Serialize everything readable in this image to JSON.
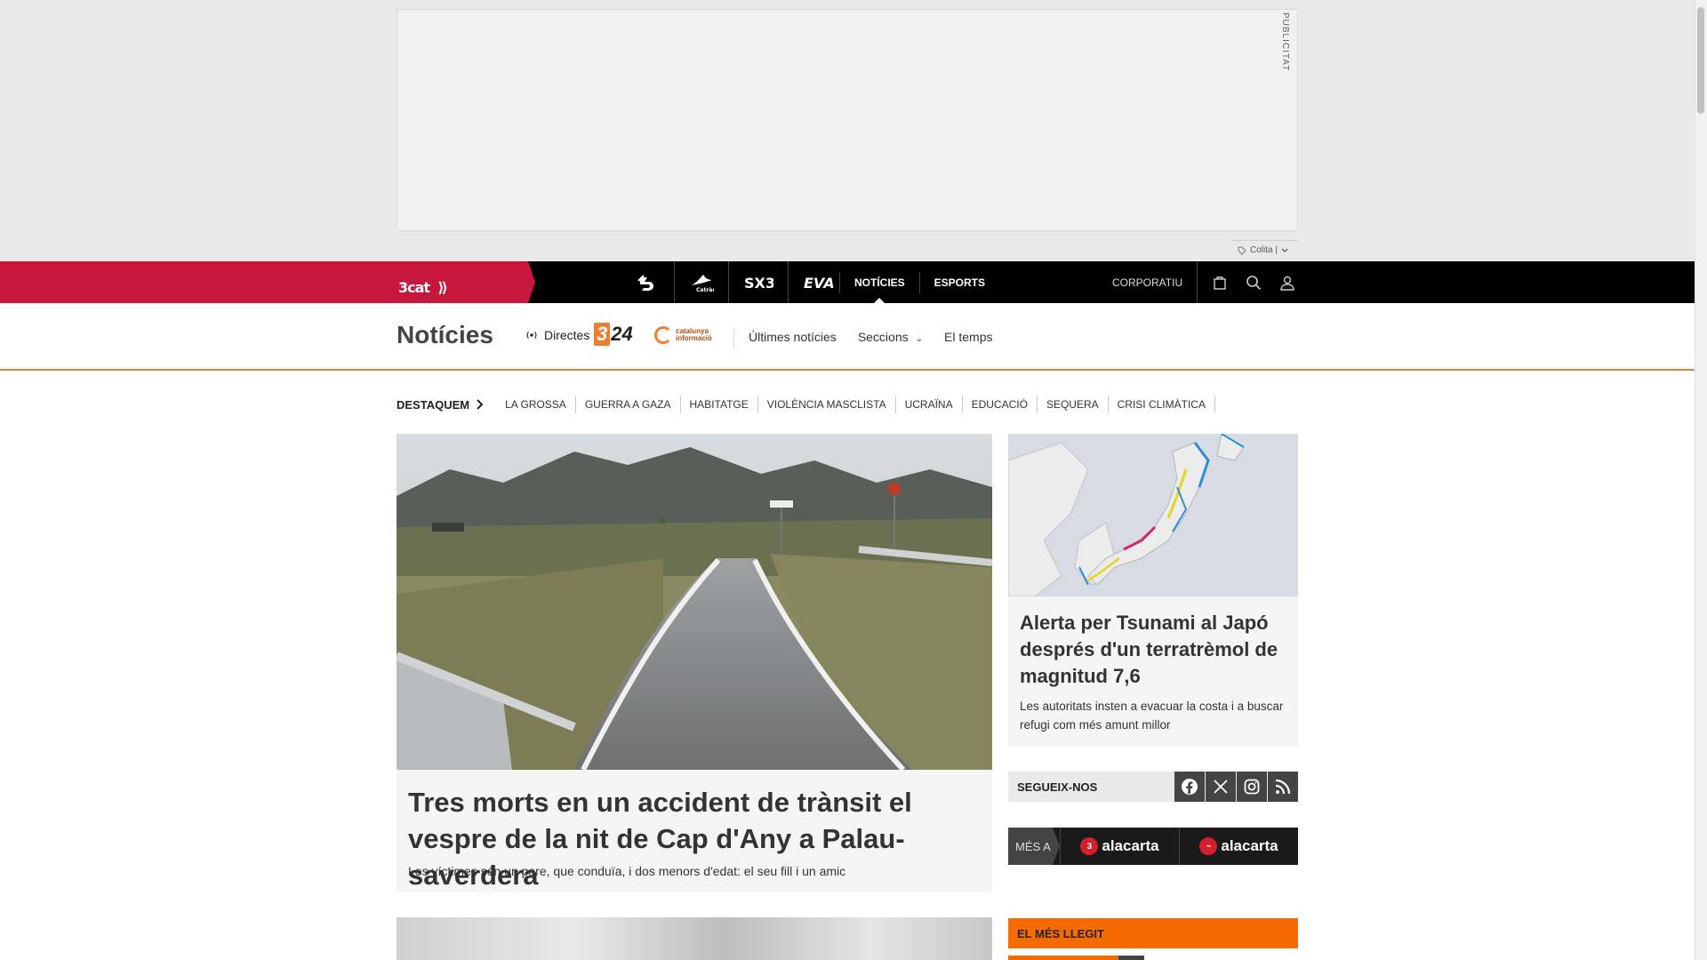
{
  "ad": {
    "label": "PUBLICITAT",
    "colita": "Colita |"
  },
  "header": {
    "brand": "3cat",
    "channels": [
      {
        "name": "3",
        "icon": "tv3-icon"
      },
      {
        "name": "Catràdio",
        "icon": "catradio-icon"
      },
      {
        "name": "SX3",
        "icon": "sx3-icon"
      },
      {
        "name": "EVA",
        "icon": "eva-icon"
      }
    ],
    "nav": [
      {
        "label": "NOTÍCIES",
        "active": true
      },
      {
        "label": "ESPORTS",
        "active": false
      }
    ],
    "corporate": "CORPORATIU"
  },
  "section": {
    "title": "Notícies",
    "directes": "Directes",
    "logo_324": "324",
    "catinfo": [
      "catalunya",
      "informació"
    ],
    "links": [
      "Últimes notícies",
      "Seccions",
      "El temps"
    ]
  },
  "highlights": {
    "title": "DESTAQUEM",
    "items": [
      "LA GROSSA",
      "GUERRA A GAZA",
      "HABITATGE",
      "VIOLÈNCIA MASCLISTA",
      "UCRAÏNA",
      "EDUCACIÓ",
      "SEQUERA",
      "CRISI CLIMÀTICA"
    ]
  },
  "main_story": {
    "title": "Tres morts en un accident de trànsit el vespre de la nit de Cap d'Any a Palau-saverdera",
    "subtitle": "Les víctimes són un pare, que conduïa, i dos menors d'edat: el seu fill i un amic"
  },
  "side_story": {
    "title": "Alerta per Tsunami al Japó després d'un terratrèmol de magnitud 7,6",
    "subtitle": "Les autoritats insten a evacuar la costa i a buscar refugi com més amunt millor"
  },
  "follow": {
    "label": "SEGUEIX-NOS",
    "icons": [
      "facebook-icon",
      "x-icon",
      "instagram-icon",
      "rss-icon"
    ]
  },
  "alacarta": {
    "label": "MÉS A",
    "items": [
      {
        "badge": "3",
        "text": "alacarta"
      },
      {
        "badge": "~",
        "text": "alacarta"
      }
    ]
  },
  "most_read": {
    "label": "EL MÉS LLEGIT"
  },
  "colors": {
    "brand": "#c8173d",
    "accent": "#f56b00",
    "topbar": "#000000"
  }
}
